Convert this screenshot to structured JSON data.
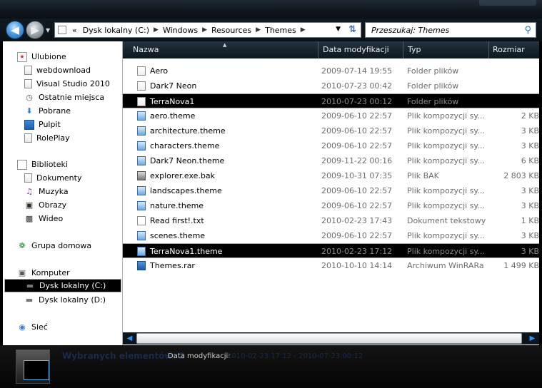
{
  "toolbar": {
    "back_icon": "back-arrow",
    "forward_icon": "forward-arrow",
    "breadcrumb": [
      "Dysk lokalny (C:)",
      "Windows",
      "Resources",
      "Themes"
    ],
    "breadcrumb_prefix": "«",
    "search_placeholder": "Przeszukaj: Themes"
  },
  "sidebar": {
    "favorites": {
      "label": "Ulubione",
      "items": [
        {
          "label": "webdownload",
          "icon": "folder-icon"
        },
        {
          "label": "Visual Studio 2010",
          "icon": "folder-icon"
        },
        {
          "label": "Ostatnie miejsca",
          "icon": "recent-places-icon"
        },
        {
          "label": "Pobrane",
          "icon": "downloads-icon"
        },
        {
          "label": "Pulpit",
          "icon": "desktop-icon"
        },
        {
          "label": "RolePlay",
          "icon": "folder-icon"
        }
      ]
    },
    "libraries": {
      "label": "Biblioteki",
      "items": [
        {
          "label": "Dokumenty",
          "icon": "documents-icon"
        },
        {
          "label": "Muzyka",
          "icon": "music-icon"
        },
        {
          "label": "Obrazy",
          "icon": "pictures-icon"
        },
        {
          "label": "Wideo",
          "icon": "video-icon"
        }
      ]
    },
    "homegroup": {
      "label": "Grupa domowa"
    },
    "computer": {
      "label": "Komputer",
      "items": [
        {
          "label": "Dysk lokalny (C:)",
          "icon": "drive-icon",
          "selected": true
        },
        {
          "label": "Dysk lokalny (D:)",
          "icon": "drive-icon",
          "selected": false
        }
      ]
    },
    "network": {
      "label": "Sieć"
    }
  },
  "columns": {
    "name": "Nazwa",
    "date": "Data modyfikacji",
    "type": "Typ",
    "size": "Rozmiar"
  },
  "files": [
    {
      "name": "Aero",
      "date": "2009-07-14 19:55",
      "type": "Folder plików",
      "size": "",
      "kind": "folder",
      "selected": false
    },
    {
      "name": "Dark7 Neon",
      "date": "2010-07-23 00:42",
      "type": "Folder plików",
      "size": "",
      "kind": "folder",
      "selected": false
    },
    {
      "name": "TerraNova1",
      "date": "2010-07-23 00:12",
      "type": "Folder plików",
      "size": "",
      "kind": "folder",
      "selected": true
    },
    {
      "name": "aero.theme",
      "date": "2009-06-10 22:57",
      "type": "Plik kompozycji sy...",
      "size": "2 KB",
      "kind": "theme",
      "selected": false
    },
    {
      "name": "architecture.theme",
      "date": "2009-06-10 22:57",
      "type": "Plik kompozycji sy...",
      "size": "3 KB",
      "kind": "theme",
      "selected": false
    },
    {
      "name": "characters.theme",
      "date": "2009-06-10 22:57",
      "type": "Plik kompozycji sy...",
      "size": "3 KB",
      "kind": "theme",
      "selected": false
    },
    {
      "name": "Dark7 Neon.theme",
      "date": "2009-11-22 00:16",
      "type": "Plik kompozycji sy...",
      "size": "6 KB",
      "kind": "theme",
      "selected": false
    },
    {
      "name": "explorer.exe.bak",
      "date": "2009-10-31 07:35",
      "type": "Plik BAK",
      "size": "2 803 KB",
      "kind": "bak",
      "selected": false
    },
    {
      "name": "landscapes.theme",
      "date": "2009-06-10 22:57",
      "type": "Plik kompozycji sy...",
      "size": "3 KB",
      "kind": "theme",
      "selected": false
    },
    {
      "name": "nature.theme",
      "date": "2009-06-10 22:57",
      "type": "Plik kompozycji sy...",
      "size": "3 KB",
      "kind": "theme",
      "selected": false
    },
    {
      "name": "Read first!.txt",
      "date": "2010-02-23 17:43",
      "type": "Dokument tekstowy",
      "size": "1 KB",
      "kind": "txt",
      "selected": false
    },
    {
      "name": "scenes.theme",
      "date": "2009-06-10 22:57",
      "type": "Plik kompozycji sy...",
      "size": "3 KB",
      "kind": "theme",
      "selected": false
    },
    {
      "name": "TerraNova1.theme",
      "date": "2010-02-23 17:12",
      "type": "Plik kompozycji sy...",
      "size": "3 KB",
      "kind": "theme",
      "selected": true
    },
    {
      "name": "Themes.rar",
      "date": "2010-10-10 14:14",
      "type": "Archiwum WinRARa",
      "size": "1 499 KB",
      "kind": "rar",
      "selected": false
    }
  ],
  "details": {
    "selection_text": "Wybranych elementów: 2",
    "date_label": "Data modyfikacji:",
    "date_value": "2010-02-23 17:12 - 2010-07-23 00:12"
  }
}
